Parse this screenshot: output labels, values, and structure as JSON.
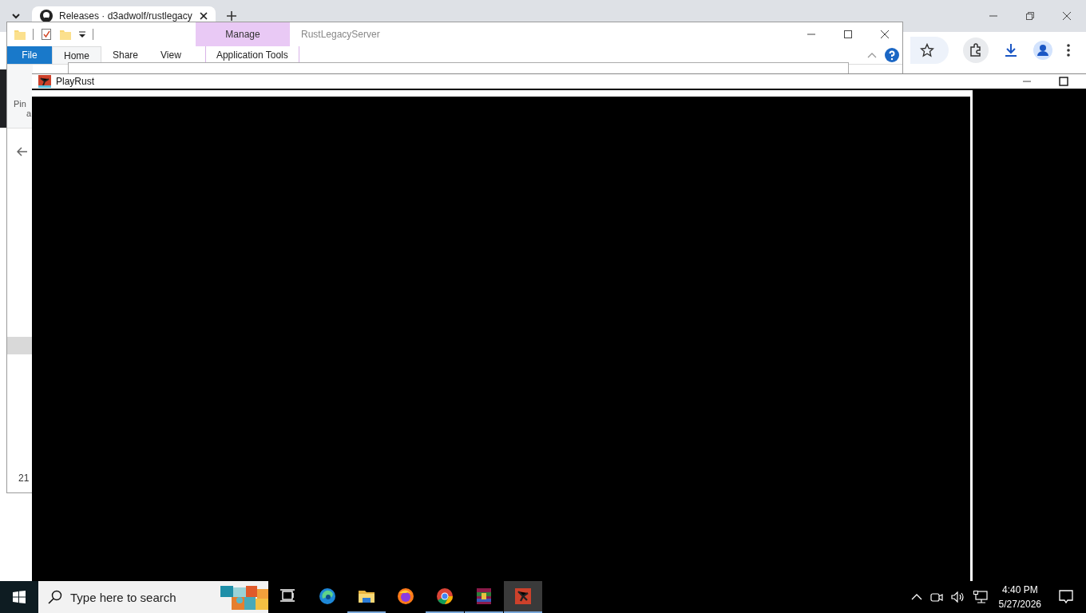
{
  "browser": {
    "tabs": [
      {
        "title": "Releases · d3adwolf/rustlegacy",
        "selected": true
      }
    ]
  },
  "explorer": {
    "title": "RustLegacyServer",
    "context_tab": "Manage",
    "ribbon_tabs": [
      {
        "label": "File",
        "kind": "file",
        "selected": false
      },
      {
        "label": "Home",
        "kind": "tab",
        "selected": true
      },
      {
        "label": "Share",
        "kind": "tab",
        "selected": false
      },
      {
        "label": "View",
        "kind": "tab",
        "selected": false
      },
      {
        "label": "Application Tools",
        "kind": "context",
        "selected": false
      }
    ],
    "ribbon_text": [
      "Pin",
      "a"
    ],
    "status_bar": "21"
  },
  "game_window": {
    "title": "PlayRust"
  },
  "taskbar": {
    "search": {
      "placeholder": "Type here to search"
    },
    "apps": [
      {
        "kind": "taskview",
        "running": false,
        "active": false
      },
      {
        "kind": "edge",
        "running": false,
        "active": false
      },
      {
        "kind": "folder",
        "running": true,
        "active": false
      },
      {
        "kind": "firefox",
        "running": false,
        "active": false
      },
      {
        "kind": "chrome",
        "running": true,
        "active": false
      },
      {
        "kind": "archive",
        "running": true,
        "active": false
      },
      {
        "kind": "rust",
        "running": true,
        "active": true
      }
    ],
    "clock": {
      "time": "4:40 PM",
      "date": "5/27/2026"
    }
  }
}
